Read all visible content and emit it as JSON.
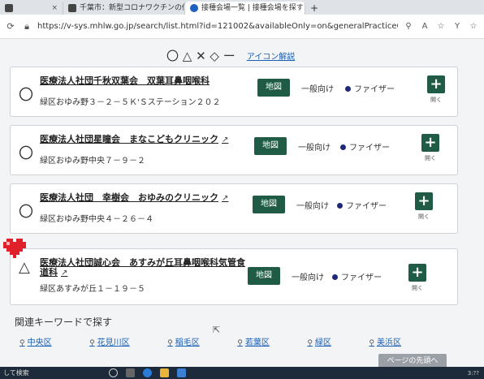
{
  "tabs": [
    {
      "label": "",
      "close": "×"
    },
    {
      "label": "千葉市：新型コロナワクチンの個別",
      "close": "×"
    },
    {
      "label": "接種会場一覧 | 接種会場を探す",
      "close": "×"
    }
  ],
  "new_tab": "+",
  "address": {
    "url": "https://v-sys.mhlw.go.jp/search/list.html?id=121002&availableOnly=on&generalPracticeOnly=on&keywo..."
  },
  "legend": {
    "symbols": "〇 △ ✕ ◇ ー",
    "icon_link": "アイコン解説"
  },
  "clinics": [
    {
      "mark": "〇",
      "name": "医療法人社団千秋双葉会　双葉耳鼻咽喉科",
      "ext": "",
      "address": "緑区おゆみ野３－２－５Ｋ'Ｓステーション２０２",
      "map": "地図",
      "general": "一般向け",
      "vaccine": "ファイザー",
      "plus": "+",
      "open": "開く"
    },
    {
      "mark": "〇",
      "name": "医療法人社団星瞳会　まなこどもクリニック",
      "ext": "↗",
      "address": "緑区おゆみ野中央７－９－２",
      "map": "地図",
      "general": "一般向け",
      "vaccine": "ファイザー",
      "plus": "+",
      "open": "開く"
    },
    {
      "mark": "〇",
      "name": "医療法人社団　幸樹会　おゆみのクリニック",
      "ext": "↗",
      "address": "緑区おゆみ野中央４－２６－４",
      "map": "地図",
      "general": "一般向け",
      "vaccine": "ファイザー",
      "plus": "+",
      "open": "開く"
    },
    {
      "mark": "△",
      "name": "医療法人社団誠心会　あすみが丘耳鼻咽喉科気管食",
      "name2": "道科",
      "ext": "↗",
      "address": "緑区あすみが丘１－１９－５",
      "map": "地図",
      "general": "一般向け",
      "vaccine": "ファイザー",
      "plus": "+",
      "open": "開く"
    }
  ],
  "keywords": {
    "title": "関連キーワードで探す",
    "items": [
      "中央区",
      "花見川区",
      "稲毛区",
      "若葉区",
      "緑区",
      "美浜区"
    ]
  },
  "page_top": "ページの先頭へ",
  "taskbar": {
    "search": "して検索",
    "time": "3:??"
  },
  "colors": {
    "accent": "#1f5b45",
    "vaccine_dot": "#1e2a78",
    "link": "#1a5fb4"
  }
}
